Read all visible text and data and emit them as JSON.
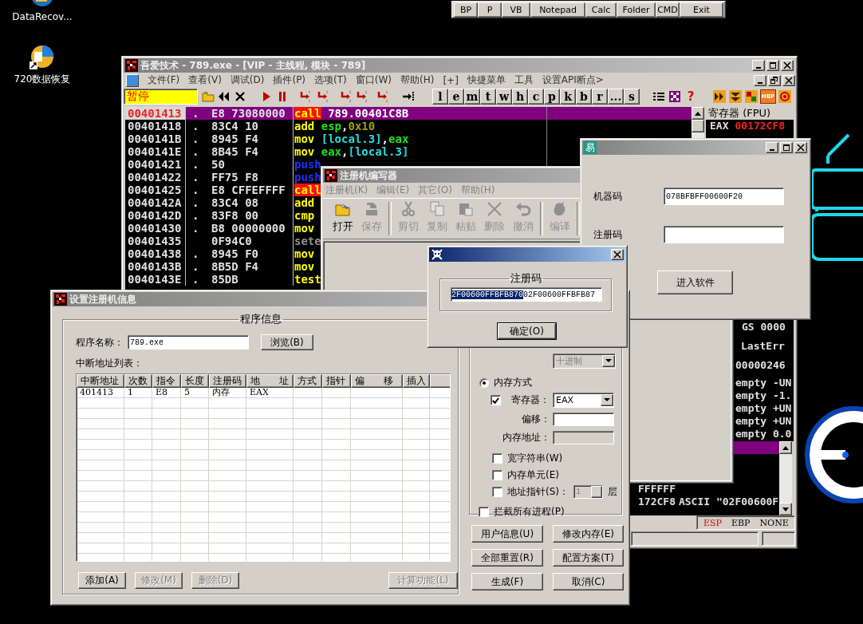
{
  "desktop": {
    "icons": [
      {
        "label": "DataRecov..."
      },
      {
        "label": "720数据恢复"
      }
    ]
  },
  "launcher": [
    "BP",
    "P",
    "VB",
    "Notepad",
    "Calc",
    "Folder",
    "CMD",
    "Exit"
  ],
  "debugger": {
    "title": "吾爱技术 - 789.exe - [VIP - 主线程, 模块 - 789]",
    "active": false,
    "menu": [
      "文件(F)",
      "查看(V)",
      "调试(D)",
      "插件(P)",
      "选项(T)",
      "窗口(W)",
      "帮助(H)",
      "[+]",
      "快捷菜单",
      "工具",
      "设置API断点>"
    ],
    "state_field": "暂停",
    "letter_buttons": [
      "l",
      "e",
      "m",
      "t",
      "w",
      "h",
      "c",
      "p",
      "k",
      "b",
      "r",
      "...",
      "s"
    ],
    "help_glyph": "?",
    "hbp_label": "HBP",
    "disassembly": [
      {
        "address": "00401413",
        "marker": ".",
        "hex": "E8 73080000",
        "mnemonic": "call",
        "kind": "call",
        "operands": [
          {
            "text": "789.00401C8B",
            "kind": "plain"
          }
        ],
        "selected": true
      },
      {
        "address": "00401418",
        "marker": ".",
        "hex": "83C4 10",
        "mnemonic": "add",
        "kind": "plain",
        "operands": [
          {
            "text": "esp",
            "kind": "reg"
          },
          {
            "text": ",",
            "kind": "plain"
          },
          {
            "text": "0x10",
            "kind": "const"
          }
        ],
        "selected": false
      },
      {
        "address": "0040141B",
        "marker": ".",
        "hex": "8945 F4",
        "mnemonic": "mov",
        "kind": "plain",
        "operands": [
          {
            "text": "[local.3]",
            "kind": "mem"
          },
          {
            "text": ",",
            "kind": "plain"
          },
          {
            "text": "eax",
            "kind": "reg"
          }
        ],
        "selected": false
      },
      {
        "address": "0040141E",
        "marker": ".",
        "hex": "8B45 F4",
        "mnemonic": "mov",
        "kind": "plain",
        "operands": [
          {
            "text": "eax",
            "kind": "reg"
          },
          {
            "text": ",",
            "kind": "plain"
          },
          {
            "text": "[local.3]",
            "kind": "mem"
          }
        ],
        "selected": false
      },
      {
        "address": "00401421",
        "marker": ".",
        "hex": "50",
        "mnemonic": "push",
        "kind": "push",
        "selected": false
      },
      {
        "address": "00401422",
        "marker": ".",
        "hex": "FF75 F8",
        "mnemonic": "push",
        "kind": "push",
        "selected": false
      },
      {
        "address": "00401425",
        "marker": ".",
        "hex": "E8 CFFEFFFF",
        "mnemonic": "call",
        "kind": "call",
        "selected": false
      },
      {
        "address": "0040142A",
        "marker": ".",
        "hex": "83C4 08",
        "mnemonic": "add",
        "kind": "plain",
        "selected": false
      },
      {
        "address": "0040142D",
        "marker": ".",
        "hex": "83F8 00",
        "mnemonic": "cmp",
        "kind": "plain",
        "selected": false
      },
      {
        "address": "00401430",
        "marker": ".",
        "hex": "B8 00000000",
        "mnemonic": "mov",
        "kind": "plain",
        "selected": false
      },
      {
        "address": "00401435",
        "hex": "0F94C0",
        "mnemonic": "sete",
        "kind": "set",
        "selected": false
      },
      {
        "address": "00401438",
        "marker": ".",
        "hex": "8945 F0",
        "mnemonic": "mov",
        "kind": "plain",
        "selected": false
      },
      {
        "address": "0040143B",
        "marker": ".",
        "hex": "8B5D F4",
        "mnemonic": "mov",
        "kind": "plain",
        "selected": false
      },
      {
        "address": "0040143E",
        "marker": ".",
        "hex": "85DB",
        "mnemonic": "test",
        "kind": "plain",
        "selected": false
      }
    ],
    "registers": {
      "title": "寄存器 (FPU)",
      "rows": [
        {
          "name": "EAX",
          "value": "00172CF8",
          "changed": true
        }
      ],
      "lower": [
        {
          "text": "GS 0000",
          "kind": "segment"
        },
        {
          "text": "LastErr",
          "kind": "lasterr"
        },
        {
          "text": "00000246",
          "kind": "flags"
        },
        {
          "text": "empty -UN",
          "kind": "fpu"
        },
        {
          "text": "empty -1.",
          "kind": "fpu"
        },
        {
          "text": "empty +UN",
          "kind": "fpu"
        },
        {
          "text": "empty +UN",
          "kind": "fpu"
        },
        {
          "text": "empty 0.0",
          "kind": "fpu"
        }
      ]
    },
    "stack": [
      {
        "selected": true
      },
      {
        "value": "FFFFFF",
        "selected": false
      },
      {
        "value": "172CF8",
        "comment": "ASCII \"02F00600F",
        "selected": false
      }
    ],
    "status": [
      {
        "label": "ESP",
        "selected": true
      },
      {
        "label": "EBP",
        "selected": false
      },
      {
        "label": "NONE",
        "selected": false
      }
    ]
  },
  "editor": {
    "title": "注册机编写器",
    "active": false,
    "menu": [
      "注册机(K)",
      "编辑(E)",
      "其它(O)",
      "帮助(H)"
    ],
    "tools": [
      {
        "label": "打开",
        "kind": "open",
        "disabled": false
      },
      {
        "label": "保存",
        "kind": "save",
        "disabled": true
      },
      {
        "label": "剪切",
        "kind": "cut",
        "disabled": true
      },
      {
        "label": "复制",
        "kind": "copy",
        "disabled": true
      },
      {
        "label": "粘贴",
        "kind": "paste",
        "disabled": true
      },
      {
        "label": "删除",
        "kind": "delete",
        "disabled": true
      },
      {
        "label": "撤消",
        "kind": "undo",
        "disabled": true
      },
      {
        "label": "编译",
        "kind": "compile",
        "disabled": true
      }
    ]
  },
  "easy": {
    "icon_text": "易",
    "active": false,
    "fields": [
      {
        "label": "机器码",
        "value": "078BFBFF00600F20"
      },
      {
        "label": "注册码"
      }
    ],
    "button": "进入软件"
  },
  "setup": {
    "title": "设置注册机信息",
    "active": false,
    "group_title": "程序信息",
    "program_label": "程序名称：",
    "program_value": "789.exe",
    "browse_button": "浏览(B)",
    "list_label": "中断地址列表：",
    "columns": [
      "中断地址",
      "次数",
      "指令",
      "长度",
      "注册码",
      "地　　址",
      "方式",
      "指针",
      "偏　　移",
      "插入"
    ],
    "rows": [
      [
        "401413",
        "1",
        "E8",
        "5",
        "内存",
        "EAX"
      ]
    ],
    "buttons": [
      {
        "label": "添加(A)",
        "disabled": false
      },
      {
        "label": "修改(M)",
        "disabled": true
      },
      {
        "label": "删除(D)",
        "disabled": true
      }
    ],
    "calc_button": {
      "label": "计算功能(L)",
      "disabled": true
    },
    "base_select": {
      "value": "十进制",
      "disabled": true
    },
    "mode_radio": {
      "label": "内存方式",
      "selected": true
    },
    "register_check": {
      "label": "寄存器：",
      "checked": true
    },
    "register_select": {
      "value": "EAX",
      "disabled": false
    },
    "offset_label": "偏移：",
    "address_label": "内存地址：",
    "checks": [
      {
        "label": "宽字符串(W)",
        "checked": false,
        "kind": "plain"
      },
      {
        "label": "内存单元(E)",
        "checked": false,
        "kind": "plain"
      },
      {
        "label": "地址指针(S)：",
        "checked": false,
        "kind": "pointer"
      }
    ],
    "pointer_spin": {
      "value": "1",
      "disabled": true
    },
    "pointer_unit": "层",
    "intercept_check": {
      "label": "拦截所有进程(P)",
      "checked": false
    },
    "actions": [
      "用户信息(U)",
      "修改内存(E)",
      "全部重置(R)",
      "配置方案(T)",
      "生成(F)",
      "取消(C)"
    ]
  },
  "popup": {
    "active": true,
    "group_title": "注册码",
    "selected_text": "2F00600FFBFB870",
    "text": "02F00600FFBFB87",
    "ok_button": "确定(O)"
  }
}
